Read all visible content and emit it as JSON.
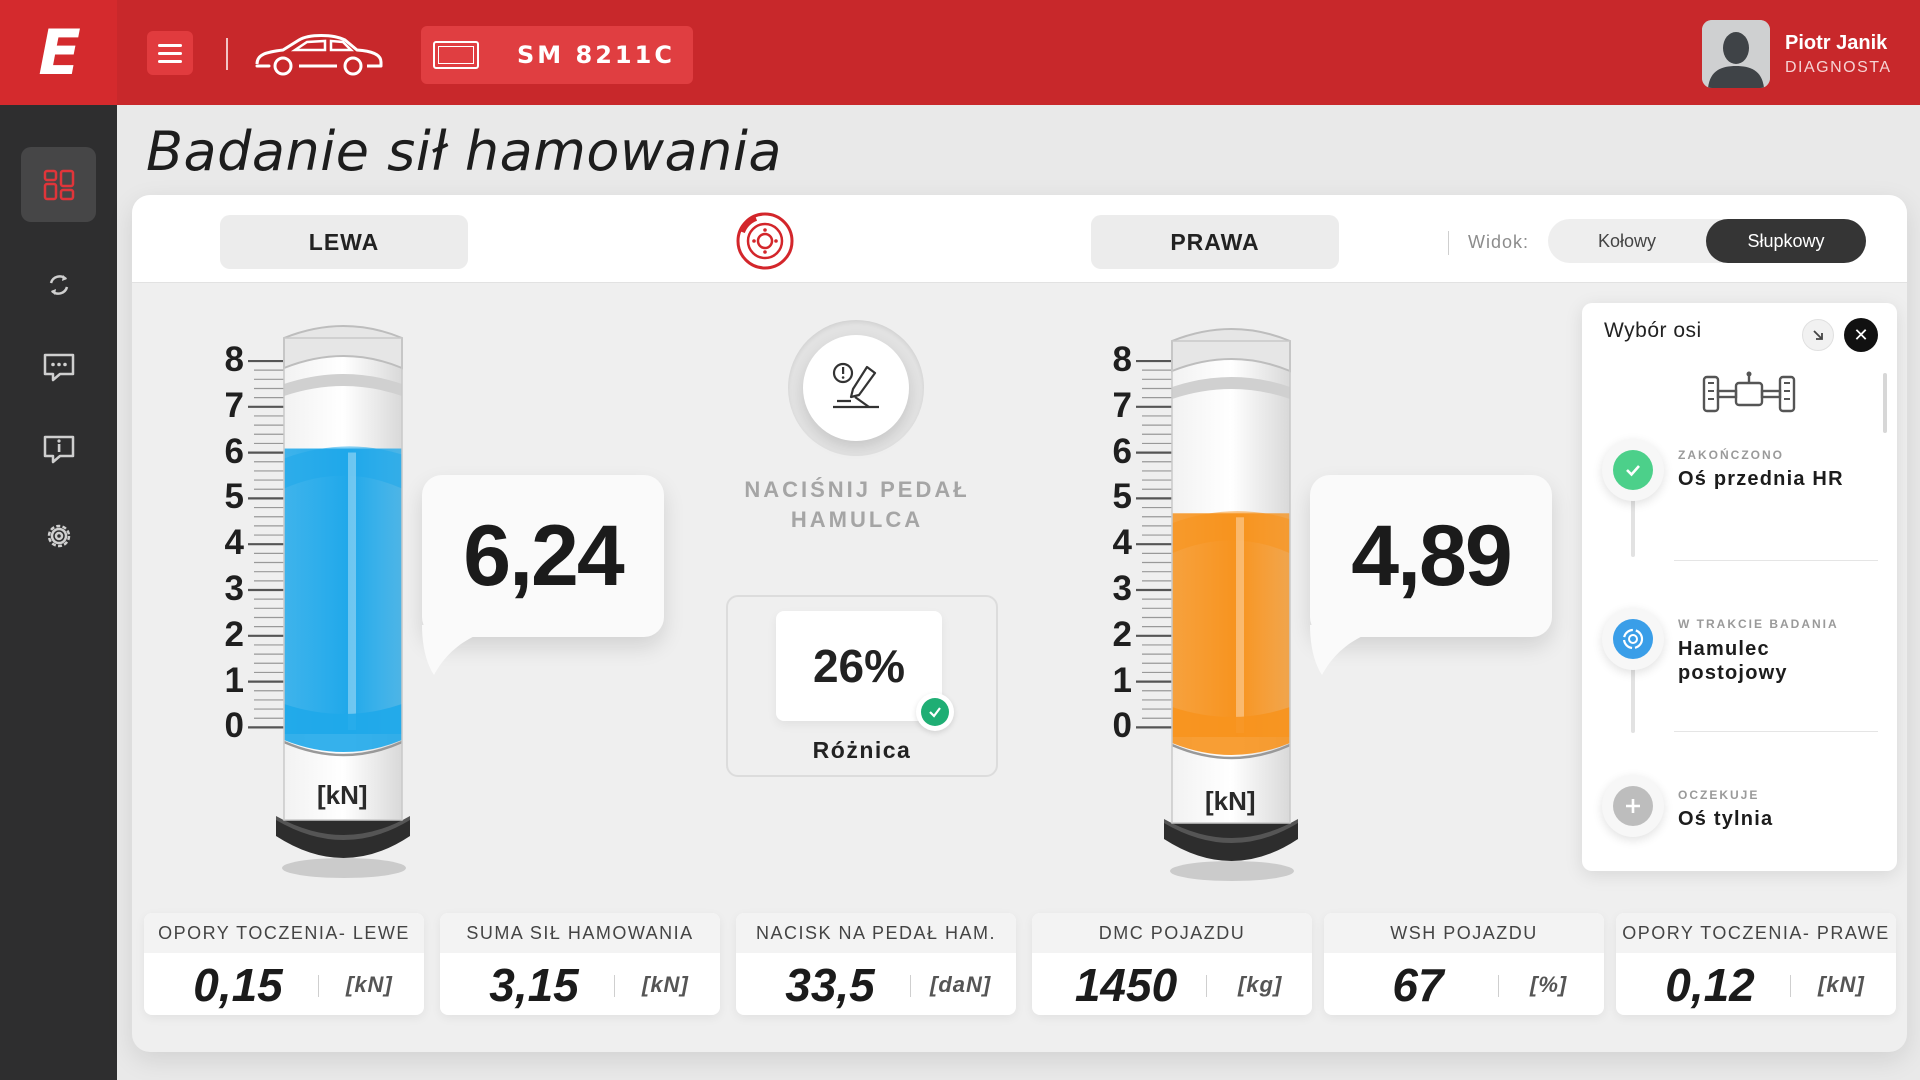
{
  "header": {
    "logo_text": "E",
    "plate": "SM 8211C",
    "user_name": "Piotr Janik",
    "user_role": "DIAGNOSTA"
  },
  "page": {
    "title": "Badanie sił hamowania"
  },
  "panel": {
    "left_tab": "LEWA",
    "right_tab": "PRAWA",
    "view_label": "Widok:",
    "view_options": [
      "Kołowy",
      "Słupkowy"
    ],
    "view_selected": "Słupkowy"
  },
  "gauges": {
    "scale_labels": [
      "8",
      "7",
      "6",
      "5",
      "4",
      "3",
      "2",
      "1",
      "0"
    ],
    "unit": "[kN]",
    "left": {
      "value_text": "6,24",
      "fill_level": 6.24,
      "color": "#1fa8ea"
    },
    "right": {
      "value_text": "4,89",
      "fill_level": 4.89,
      "color": "#f7931e"
    }
  },
  "center": {
    "instruction": "NACIŚNIJ PEDAŁ HAMULCA",
    "difference_value": "26%",
    "difference_label": "Różnica"
  },
  "axis_panel": {
    "title": "Wybór osi",
    "steps": [
      {
        "status": "ZAKOŃCZONO",
        "name": "Oś przednia HR",
        "state": "done",
        "color": "#4cd08a"
      },
      {
        "status": "W TRAKCIE BADANIA",
        "name": "Hamulec postojowy",
        "state": "in-progress",
        "color": "#3a9ee8"
      },
      {
        "status": "OCZEKUJE",
        "name": "Oś tylnia",
        "state": "pending",
        "color": "#bdbdbd"
      }
    ]
  },
  "stats": [
    {
      "label": "OPORY TOCZENIA- LEWE",
      "value": "0,15",
      "unit": "[kN]"
    },
    {
      "label": "SUMA SIŁ HAMOWANIA",
      "value": "3,15",
      "unit": "[kN]"
    },
    {
      "label": "NACISK NA PEDAŁ HAM.",
      "value": "33,5",
      "unit": "[daN]"
    },
    {
      "label": "DMC POJAZDU",
      "value": "1450",
      "unit": "[kg]"
    },
    {
      "label": "WSH POJAZDU",
      "value": "67",
      "unit": "[%]"
    },
    {
      "label": "OPORY TOCZENIA- PRAWE",
      "value": "0,12",
      "unit": "[kN]"
    }
  ],
  "colors": {
    "brand_red": "#c8282b",
    "sidebar": "#2e2e2f",
    "success": "#1fae74"
  }
}
